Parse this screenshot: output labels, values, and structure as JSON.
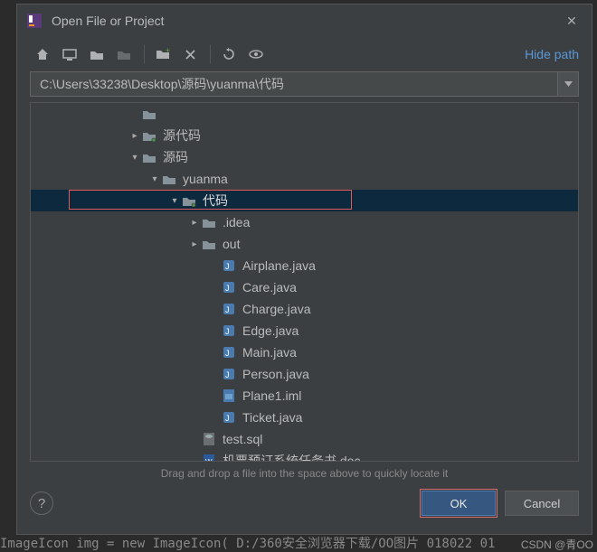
{
  "window": {
    "title": "Open File or Project",
    "hide_path": "Hide path",
    "path": "C:\\Users\\33238\\Desktop\\源码\\yuanma\\代码",
    "hint": "Drag and drop a file into the space above to quickly locate it",
    "ok": "OK",
    "cancel": "Cancel"
  },
  "tree": {
    "rows": [
      {
        "indent": 108,
        "chev": "",
        "icon": "folder",
        "label": "",
        "truncated": true
      },
      {
        "indent": 108,
        "chev": ">",
        "icon": "folder-dot",
        "label": "源代码"
      },
      {
        "indent": 108,
        "chev": "v",
        "icon": "folder",
        "label": "源码"
      },
      {
        "indent": 130,
        "chev": "v",
        "icon": "folder",
        "label": "yuanma"
      },
      {
        "indent": 152,
        "chev": "v",
        "icon": "folder-dot",
        "label": "代码",
        "selected": true
      },
      {
        "indent": 174,
        "chev": ">",
        "icon": "folder",
        "label": ".idea"
      },
      {
        "indent": 174,
        "chev": ">",
        "icon": "folder",
        "label": "out"
      },
      {
        "indent": 196,
        "chev": "",
        "icon": "java",
        "label": "Airplane.java"
      },
      {
        "indent": 196,
        "chev": "",
        "icon": "java",
        "label": "Care.java"
      },
      {
        "indent": 196,
        "chev": "",
        "icon": "java",
        "label": "Charge.java"
      },
      {
        "indent": 196,
        "chev": "",
        "icon": "java",
        "label": "Edge.java"
      },
      {
        "indent": 196,
        "chev": "",
        "icon": "java",
        "label": "Main.java"
      },
      {
        "indent": 196,
        "chev": "",
        "icon": "java",
        "label": "Person.java"
      },
      {
        "indent": 196,
        "chev": "",
        "icon": "iml",
        "label": "Plane1.iml"
      },
      {
        "indent": 196,
        "chev": "",
        "icon": "java",
        "label": "Ticket.java"
      },
      {
        "indent": 174,
        "chev": "",
        "icon": "sql",
        "label": "test.sql"
      },
      {
        "indent": 174,
        "chev": "",
        "icon": "doc",
        "label": "机票预订系统任务书.doc"
      }
    ]
  },
  "watermark": "CSDN @青OO",
  "bg_code": "ImageIcon img = new ImageIcon( D:/360安全浏览器下载/OO图片 018022 01"
}
